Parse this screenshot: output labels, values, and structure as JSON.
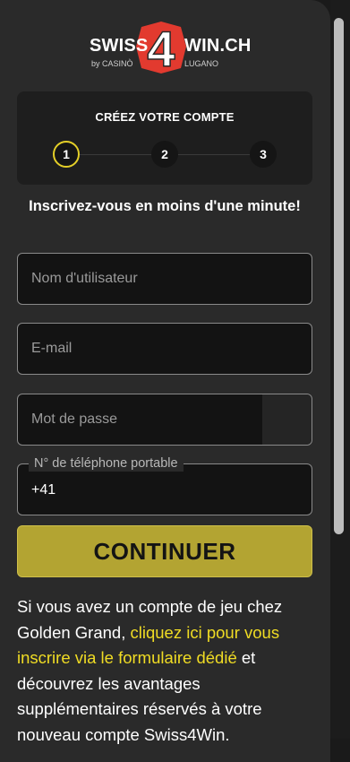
{
  "brand": {
    "name_left": "SWISS",
    "name_right": "WIN.CH",
    "sub_left": "by CASINÒ",
    "sub_right": "LUGANO",
    "mark_number": "4",
    "colors": {
      "mark_red": "#e23a2f",
      "accent": "#e4cf28",
      "button": "#b3a432",
      "link": "#f0dc24"
    }
  },
  "steps": {
    "title": "CRÉEZ VOTRE COMPTE",
    "items": [
      {
        "label": "1",
        "state": "active"
      },
      {
        "label": "2",
        "state": "inactive"
      },
      {
        "label": "3",
        "state": "inactive"
      }
    ]
  },
  "tagline": "Inscrivez-vous en moins d'une minute!",
  "form": {
    "username_placeholder": "Nom d'utilisateur",
    "email_placeholder": "E-mail",
    "password_placeholder": "Mot de passe",
    "phone_label": "N° de téléphone portable",
    "phone_prefix": "+41",
    "submit_label": "CONTINUER"
  },
  "info": {
    "text_before": "Si vous avez un compte de jeu chez Golden Grand, ",
    "link_text": "cliquez ici pour vous inscrire via le formulaire dédié",
    "text_after": " et découvrez les avantages supplémentaires réservés à votre nouveau compte Swiss4Win."
  }
}
